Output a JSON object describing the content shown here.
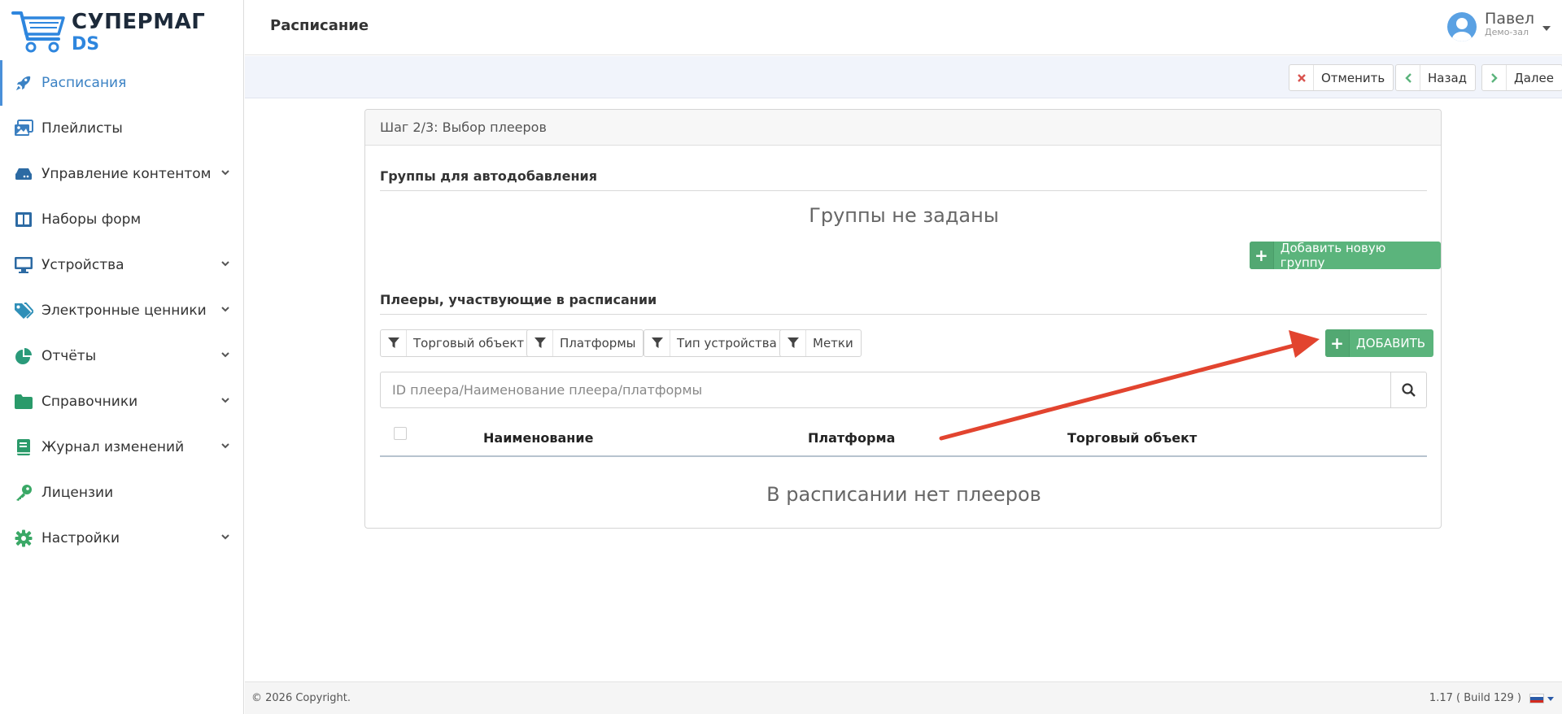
{
  "brand": {
    "name": "СУПЕРМАГ",
    "sub": "DS",
    "accent": "#2e86de"
  },
  "sidebar": {
    "items": [
      {
        "label": "Расписания",
        "icon": "rocket-icon",
        "active": true,
        "expandable": false
      },
      {
        "label": "Плейлисты",
        "icon": "images-icon",
        "expandable": false
      },
      {
        "label": "Управление контентом",
        "icon": "drive-icon",
        "expandable": true
      },
      {
        "label": "Наборы форм",
        "icon": "columns-icon",
        "expandable": false
      },
      {
        "label": "Устройства",
        "icon": "monitor-icon",
        "expandable": true
      },
      {
        "label": "Электронные ценники",
        "icon": "tags-icon",
        "expandable": true
      },
      {
        "label": "Отчёты",
        "icon": "pie-chart-icon",
        "expandable": true
      },
      {
        "label": "Справочники",
        "icon": "folder-icon",
        "expandable": true
      },
      {
        "label": "Журнал изменений",
        "icon": "book-icon",
        "expandable": true
      },
      {
        "label": "Лицензии",
        "icon": "key-icon",
        "expandable": false
      },
      {
        "label": "Настройки",
        "icon": "gear-icon",
        "expandable": true
      }
    ]
  },
  "header": {
    "title": "Расписание",
    "user": {
      "name": "Павел",
      "sub": "Демо-зал"
    }
  },
  "toolbar": {
    "cancel_label": "Отменить",
    "back_label": "Назад",
    "next_label": "Далее"
  },
  "wizard": {
    "step_title": "Шаг 2/3: Выбор плееров",
    "groups": {
      "title": "Группы для автодобавления",
      "empty": "Группы не заданы",
      "add_label": "Добавить новую группу"
    },
    "players": {
      "title": "Плееры, участвующие в расписании",
      "filters": [
        "Торговый объект",
        "Платформы",
        "Тип устройства",
        "Метки"
      ],
      "add_label": "ДОБАВИТЬ",
      "search_placeholder": "ID плеера/Наименование плеера/платформы",
      "columns": [
        "Наименование",
        "Платформа",
        "Торговый объект"
      ],
      "empty": "В расписании нет плееров"
    }
  },
  "footer": {
    "copyright": "© 2026 Copyright.",
    "build": "1.17 ( Build 129 )"
  },
  "colors": {
    "green": "#5bb47c",
    "red_x": "#d9534f",
    "arrow": "#e2442f"
  }
}
